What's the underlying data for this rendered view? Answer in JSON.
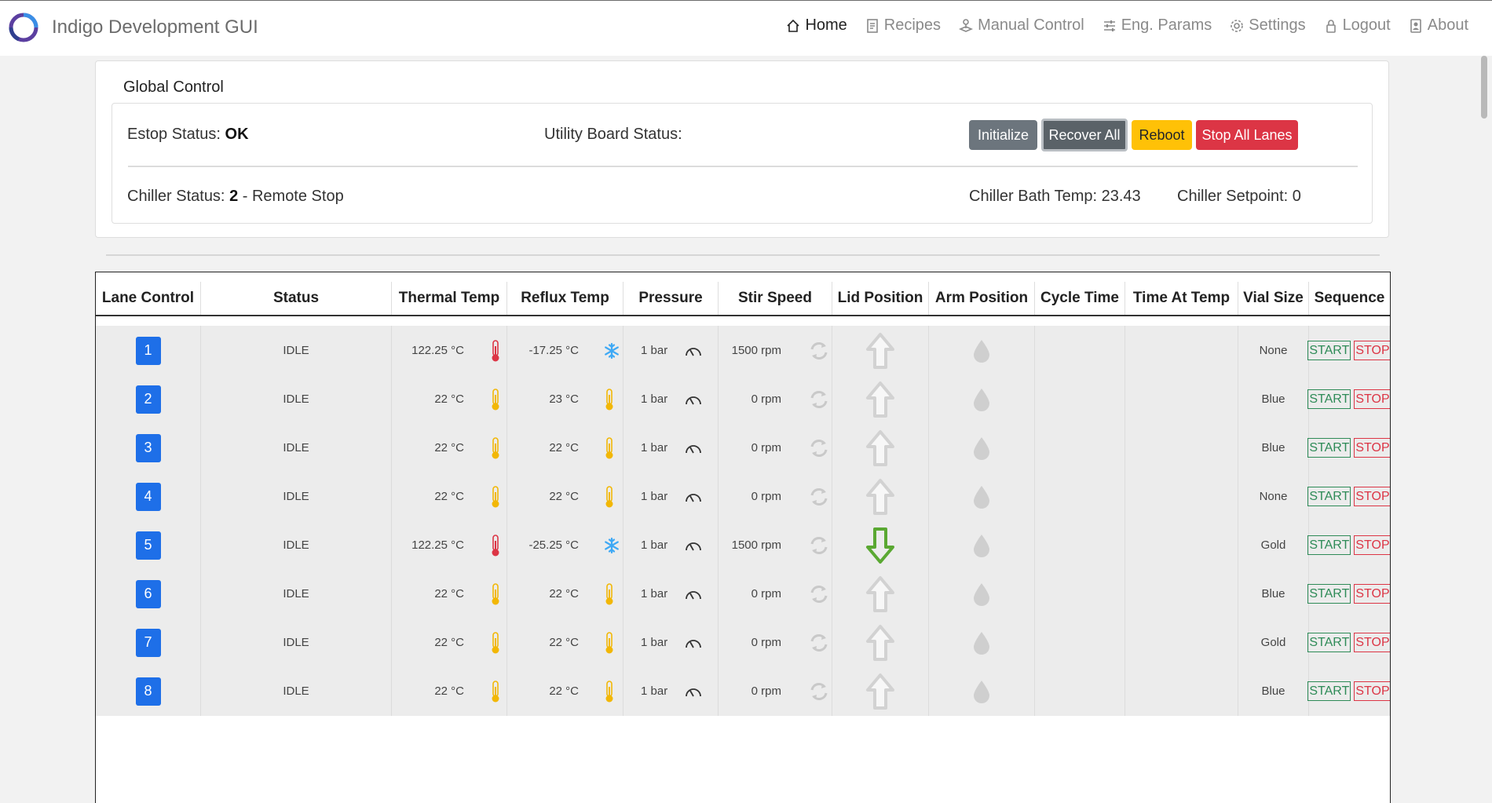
{
  "app": {
    "title": "Indigo Development GUI"
  },
  "nav": [
    {
      "label": "Home",
      "icon": "home-icon",
      "active": true
    },
    {
      "label": "Recipes",
      "icon": "recipes-icon",
      "active": false
    },
    {
      "label": "Manual Control",
      "icon": "joystick-icon",
      "active": false
    },
    {
      "label": "Eng. Params",
      "icon": "sliders-icon",
      "active": false
    },
    {
      "label": "Settings",
      "icon": "gear-icon",
      "active": false
    },
    {
      "label": "Logout",
      "icon": "lock-icon",
      "active": false
    },
    {
      "label": "About",
      "icon": "person-badge-icon",
      "active": false
    }
  ],
  "global_control": {
    "title": "Global Control",
    "estop_label": "Estop Status: ",
    "estop_value": "OK",
    "utility_label": "Utility Board Status:",
    "chiller_label": "Chiller Status: ",
    "chiller_code": "2",
    "chiller_text": " - Remote Stop",
    "bath_temp": "Chiller Bath Temp: 23.43",
    "setpoint": "Chiller Setpoint: 0",
    "buttons": {
      "initialize": "Initialize",
      "recover_all": "Recover All",
      "reboot": "Reboot",
      "stop_all": "Stop All Lanes"
    }
  },
  "table": {
    "headers": [
      "Lane Control",
      "Status",
      "Thermal Temp",
      "Reflux Temp",
      "Pressure",
      "Stir Speed",
      "Lid Position",
      "Arm Position",
      "Cycle Time",
      "Time At Temp",
      "Vial Size",
      "Sequence"
    ],
    "start_label": "START",
    "stop_label": "STOP",
    "rows": [
      {
        "lane": "1",
        "status": "IDLE",
        "thermal": "122.25 °C",
        "thermal_icon": "thermometer-hot",
        "reflux": "-17.25 °C",
        "reflux_icon": "snowflake",
        "pressure": "1 bar",
        "stir": "1500 rpm",
        "lid": "up",
        "vial": "None"
      },
      {
        "lane": "2",
        "status": "IDLE",
        "thermal": "22 °C",
        "thermal_icon": "thermometer-ambient",
        "reflux": "23 °C",
        "reflux_icon": "thermometer-ambient",
        "pressure": "1 bar",
        "stir": "0 rpm",
        "lid": "up",
        "vial": "Blue"
      },
      {
        "lane": "3",
        "status": "IDLE",
        "thermal": "22 °C",
        "thermal_icon": "thermometer-ambient",
        "reflux": "22 °C",
        "reflux_icon": "thermometer-ambient",
        "pressure": "1 bar",
        "stir": "0 rpm",
        "lid": "up",
        "vial": "Blue"
      },
      {
        "lane": "4",
        "status": "IDLE",
        "thermal": "22 °C",
        "thermal_icon": "thermometer-ambient",
        "reflux": "22 °C",
        "reflux_icon": "thermometer-ambient",
        "pressure": "1 bar",
        "stir": "0 rpm",
        "lid": "up",
        "vial": "None"
      },
      {
        "lane": "5",
        "status": "IDLE",
        "thermal": "122.25 °C",
        "thermal_icon": "thermometer-hot",
        "reflux": "-25.25 °C",
        "reflux_icon": "snowflake",
        "pressure": "1 bar",
        "stir": "1500 rpm",
        "lid": "down",
        "vial": "Gold"
      },
      {
        "lane": "6",
        "status": "IDLE",
        "thermal": "22 °C",
        "thermal_icon": "thermometer-ambient",
        "reflux": "22 °C",
        "reflux_icon": "thermometer-ambient",
        "pressure": "1 bar",
        "stir": "0 rpm",
        "lid": "up",
        "vial": "Blue"
      },
      {
        "lane": "7",
        "status": "IDLE",
        "thermal": "22 °C",
        "thermal_icon": "thermometer-ambient",
        "reflux": "22 °C",
        "reflux_icon": "thermometer-ambient",
        "pressure": "1 bar",
        "stir": "0 rpm",
        "lid": "up",
        "vial": "Gold"
      },
      {
        "lane": "8",
        "status": "IDLE",
        "thermal": "22 °C",
        "thermal_icon": "thermometer-ambient",
        "reflux": "22 °C",
        "reflux_icon": "thermometer-ambient",
        "pressure": "1 bar",
        "stir": "0 rpm",
        "lid": "up",
        "vial": "Blue"
      }
    ]
  },
  "colors": {
    "lane_button": "#1e6fe8",
    "hot": "#dc3545",
    "ambient": "#f2b705",
    "cold": "#3fa9f5",
    "lid_down": "#5aa832",
    "lid_up": "#d2d2d2"
  }
}
